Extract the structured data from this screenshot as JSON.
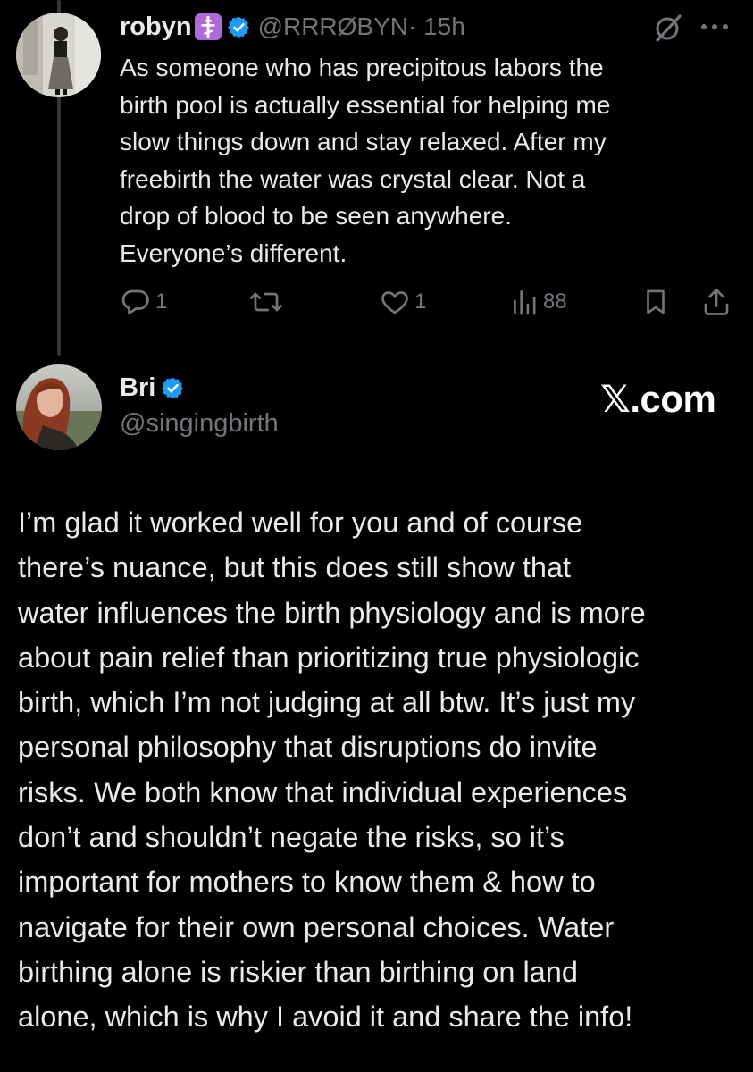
{
  "reply_tweet": {
    "author_name": "robyn",
    "handle": "@RRRØBYN",
    "time": " · 15h",
    "text_lines": [
      "As someone who has precipitous labors the",
      "birth pool is actually essential for helping me",
      "slow things down and stay relaxed. After my",
      "freebirth the water was crystal clear. Not a",
      "drop of blood to be seen anywhere.",
      "Everyone’s different."
    ],
    "actions": {
      "replies": "1",
      "retweets": "",
      "likes": "1",
      "views": "88"
    }
  },
  "main_tweet": {
    "author_name": "Bri",
    "handle": "@singingbirth",
    "watermark": "𝕏.com",
    "text_lines": [
      "I’m glad it worked well for you and of course",
      "there’s nuance, but this does still show that",
      "water influences the birth physiology and is more",
      "about pain relief than prioritizing true physiologic",
      "birth, which I’m not judging at all btw. It’s just my",
      "personal philosophy that disruptions do invite",
      "risks. We both know that individual experiences",
      "don’t and shouldn’t negate the risks, so it’s",
      "important for mothers to know them & how to",
      "navigate for their own personal choices. Water",
      "birthing alone is riskier than birthing on land",
      "alone, which is why I avoid it and share the info!"
    ]
  },
  "icons": {
    "emoji": "orthodox-cross-emoji",
    "verified": "verified-badge-icon",
    "grok": "grok-icon",
    "more": "more-dots-icon",
    "reply": "reply-icon",
    "retweet": "retweet-icon",
    "like": "heart-icon",
    "views": "views-icon",
    "bookmark": "bookmark-icon",
    "share": "share-icon"
  },
  "colors": {
    "background": "#000000",
    "text": "#e7e9ea",
    "secondary": "#71767b",
    "verified": "#1d9bf0",
    "emoji_bg": "#b069d8"
  }
}
